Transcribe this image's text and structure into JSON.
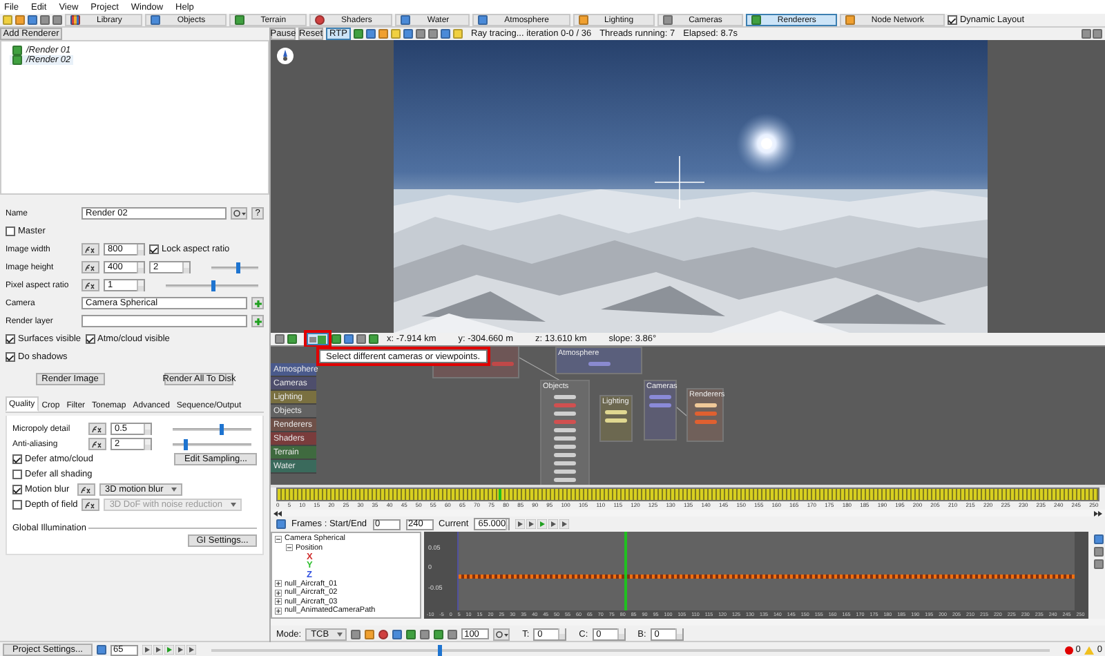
{
  "menu": [
    "File",
    "Edit",
    "View",
    "Project",
    "Window",
    "Help"
  ],
  "toolbar": {
    "tabs": [
      {
        "label": "Library",
        "selected": false
      },
      {
        "label": "Objects",
        "selected": false
      },
      {
        "label": "Terrain",
        "selected": false
      },
      {
        "label": "Shaders",
        "selected": false
      },
      {
        "label": "Water",
        "selected": false
      },
      {
        "label": "Atmosphere",
        "selected": false
      },
      {
        "label": "Lighting",
        "selected": false
      },
      {
        "label": "Cameras",
        "selected": false
      },
      {
        "label": "Renderers",
        "selected": true
      },
      {
        "label": "Node Network",
        "selected": false
      }
    ],
    "dynamic_layout": {
      "label": "Dynamic Layout",
      "checked": true
    }
  },
  "renderers": {
    "add_button": "Add Renderer",
    "items": [
      {
        "label": "/Render 01",
        "selected": false
      },
      {
        "label": "/Render 02",
        "selected": true
      }
    ]
  },
  "properties": [
    [
      {
        "kind": "label",
        "text": "Name"
      },
      {
        "kind": "field",
        "value": "Render 02"
      },
      {
        "kind": "menu-button"
      },
      {
        "kind": "help-button",
        "label": "?"
      }
    ],
    [
      {
        "kind": "check",
        "label": "Master",
        "checked": false
      }
    ],
    [
      {
        "kind": "label",
        "text": "Image width"
      },
      {
        "kind": "fx"
      },
      {
        "kind": "spin",
        "value": "800"
      },
      {
        "kind": "check",
        "label": "Lock aspect ratio",
        "checked": true
      }
    ],
    [
      {
        "kind": "label",
        "text": "Image height"
      },
      {
        "kind": "fx"
      },
      {
        "kind": "spin",
        "value": "400"
      },
      {
        "kind": "spin",
        "value": "2"
      },
      {
        "kind": "slider",
        "level": 0.55
      }
    ],
    [
      {
        "kind": "label",
        "text": "Pixel aspect ratio"
      },
      {
        "kind": "fx"
      },
      {
        "kind": "spin",
        "value": "1"
      },
      {
        "kind": "slider",
        "level": 0.5
      }
    ],
    [
      {
        "kind": "label",
        "text": "Camera"
      },
      {
        "kind": "field",
        "value": "Camera Spherical"
      },
      {
        "kind": "add-button"
      }
    ],
    [
      {
        "kind": "label",
        "text": "Render layer"
      },
      {
        "kind": "field"
      },
      {
        "kind": "add-button"
      }
    ],
    [
      {
        "kind": "check",
        "label": "Surfaces visible",
        "checked": true
      },
      {
        "kind": "check",
        "label": "Atmo/cloud visible",
        "checked": true
      }
    ],
    [
      {
        "kind": "check",
        "label": "Do shadows",
        "checked": true
      }
    ]
  ],
  "render_buttons": [
    "Render Image",
    "Render All To Disk"
  ],
  "tabs": [
    {
      "label": "Quality",
      "selected": true
    },
    {
      "label": "Crop",
      "selected": false
    },
    {
      "label": "Filter",
      "selected": false
    },
    {
      "label": "Tonemap",
      "selected": false
    },
    {
      "label": "Advanced",
      "selected": false
    },
    {
      "label": "Sequence/Output",
      "selected": false
    }
  ],
  "quality": [
    [
      {
        "kind": "label",
        "text": "Micropoly detail"
      },
      {
        "kind": "fx"
      },
      {
        "kind": "spin",
        "value": "0.5"
      },
      {
        "kind": "slider",
        "level": 0.62
      }
    ],
    [
      {
        "kind": "label",
        "text": "Anti-aliasing"
      },
      {
        "kind": "fx"
      },
      {
        "kind": "spin",
        "value": "2"
      },
      {
        "kind": "slider",
        "level": 0.15
      }
    ],
    [
      {
        "kind": "check",
        "label": "Defer atmo/cloud",
        "checked": true
      },
      {
        "kind": "button",
        "label": "Edit Sampling..."
      }
    ],
    [
      {
        "kind": "check",
        "label": "Defer all shading",
        "checked": false
      }
    ],
    [
      {
        "kind": "check",
        "label": "Motion blur",
        "checked": true
      },
      {
        "kind": "fx"
      },
      {
        "kind": "dropdown",
        "value": "3D motion blur",
        "disabled": false
      }
    ],
    [
      {
        "kind": "check",
        "label": "Depth of field",
        "checked": false
      },
      {
        "kind": "fx"
      },
      {
        "kind": "dropdown",
        "value": "3D DoF with noise reduction",
        "disabled": true
      }
    ]
  ],
  "global_illumination": {
    "title": "Global Illumination",
    "button": "GI Settings..."
  },
  "render_toolbar": {
    "buttons": [
      {
        "label": "Pause",
        "selected": false
      },
      {
        "label": "Reset",
        "selected": false
      },
      {
        "label": "RTP",
        "selected": true
      }
    ],
    "status": [
      "Ray tracing... iteration 0-0 / 36",
      "Threads running: 7",
      "Elapsed: 8.7s"
    ]
  },
  "viewport_toolbar": {
    "readouts": [
      "x: -7.914 km",
      "y: -304.660 m",
      "z: 13.610 km",
      "slope: 3.86°"
    ],
    "tooltip": "Select different cameras or viewpoints."
  },
  "node_network": {
    "categories": [
      {
        "label": "Atmosphere",
        "color": "#4a5a8c"
      },
      {
        "label": "Cameras",
        "color": "#4e4e6c"
      },
      {
        "label": "Lighting",
        "color": "#7a7040"
      },
      {
        "label": "Objects",
        "color": "#626262"
      },
      {
        "label": "Renderers",
        "color": "#6e5048"
      },
      {
        "label": "Shaders",
        "color": "#7a3c3c"
      },
      {
        "label": "Terrain",
        "color": "#3f6a3f"
      },
      {
        "label": "Water",
        "color": "#3a6a5c"
      }
    ],
    "nodes": [
      {
        "color": "#6e5656",
        "ports": [
          {
            "color": "#c04848"
          }
        ]
      },
      {
        "title": "Atmosphere",
        "color": "#5a5f7c",
        "ports": [
          {
            "color": "#8a8ad0"
          }
        ]
      },
      {
        "title": "Objects",
        "color": "#6a6a6a",
        "ports": [
          {
            "color": "#cfcfcf"
          },
          {
            "color": "#d05050"
          },
          {
            "color": "#cfcfcf"
          },
          {
            "color": "#d05050"
          },
          {
            "color": "#cfcfcf"
          },
          {
            "color": "#cfcfcf"
          },
          {
            "color": "#cfcfcf"
          },
          {
            "color": "#cfcfcf"
          },
          {
            "color": "#cfcfcf"
          },
          {
            "color": "#cfcfcf"
          },
          {
            "color": "#cfcfcf"
          }
        ]
      },
      {
        "title": "Lighting",
        "color": "#6c6850",
        "ports": [
          {
            "color": "#e0d890"
          },
          {
            "color": "#e0d890"
          }
        ]
      },
      {
        "title": "Cameras",
        "color": "#5c5c72",
        "ports": [
          {
            "color": "#8a8ad8"
          },
          {
            "color": "#8a8ad8"
          }
        ]
      },
      {
        "title": "Renderers",
        "color": "#70605a",
        "ports": [
          {
            "color": "#f0c898"
          },
          {
            "color": "#e06030"
          },
          {
            "color": "#e06030"
          }
        ]
      }
    ]
  },
  "timeline": {
    "ruler_ticks": [
      "0",
      "5",
      "10",
      "15",
      "20",
      "25",
      "30",
      "35",
      "40",
      "45",
      "50",
      "55",
      "60",
      "65",
      "70",
      "75",
      "80",
      "85",
      "90",
      "95",
      "100",
      "105",
      "110",
      "115",
      "120",
      "125",
      "130",
      "135",
      "140",
      "145",
      "150",
      "155",
      "160",
      "165",
      "170",
      "175",
      "180",
      "185",
      "190",
      "195",
      "200",
      "205",
      "210",
      "215",
      "220",
      "225",
      "230",
      "235",
      "240",
      "245",
      "250"
    ]
  },
  "animation": {
    "frames_label": "Frames : Start/End",
    "start": "0",
    "end": "240",
    "current_label": "Current",
    "current": "65.000",
    "tree": [
      {
        "label": "Camera Spherical",
        "expanded": true,
        "children": [
          {
            "label": "Position",
            "expanded": true,
            "children": [
              {
                "label": "X",
                "color": "#d03030"
              },
              {
                "label": "Y",
                "color": "#30c030"
              },
              {
                "label": "Z",
                "color": "#3050e0"
              }
            ]
          }
        ]
      },
      {
        "label": "null_Aircraft_01",
        "expanded": false
      },
      {
        "label": "null_Aircraft_02",
        "expanded": false
      },
      {
        "label": "null_Aircraft_03",
        "expanded": false
      },
      {
        "label": "null_AnimatedCameraPath",
        "expanded": false
      }
    ],
    "graph": {
      "yticks": [
        "0.05",
        "0",
        "-0.05"
      ],
      "xticks": [
        "-10",
        "-5",
        "0",
        "5",
        "10",
        "15",
        "20",
        "25",
        "30",
        "35",
        "40",
        "45",
        "50",
        "55",
        "60",
        "65",
        "70",
        "75",
        "80",
        "85",
        "90",
        "95",
        "100",
        "105",
        "110",
        "115",
        "120",
        "125",
        "130",
        "135",
        "140",
        "145",
        "150",
        "155",
        "160",
        "165",
        "170",
        "175",
        "180",
        "185",
        "190",
        "195",
        "200",
        "205",
        "210",
        "215",
        "220",
        "225",
        "230",
        "235",
        "240",
        "245",
        "250"
      ]
    },
    "mode_label": "Mode:",
    "mode": "TCB",
    "scale": "100",
    "tcb": [
      {
        "label": "T:",
        "value": "0"
      },
      {
        "label": "C:",
        "value": "0"
      },
      {
        "label": "B:",
        "value": "0"
      }
    ]
  },
  "status_bar": {
    "settings_button": "Project Settings...",
    "frame": "65",
    "level": 0.27,
    "errors": "0",
    "warnings": "0"
  }
}
